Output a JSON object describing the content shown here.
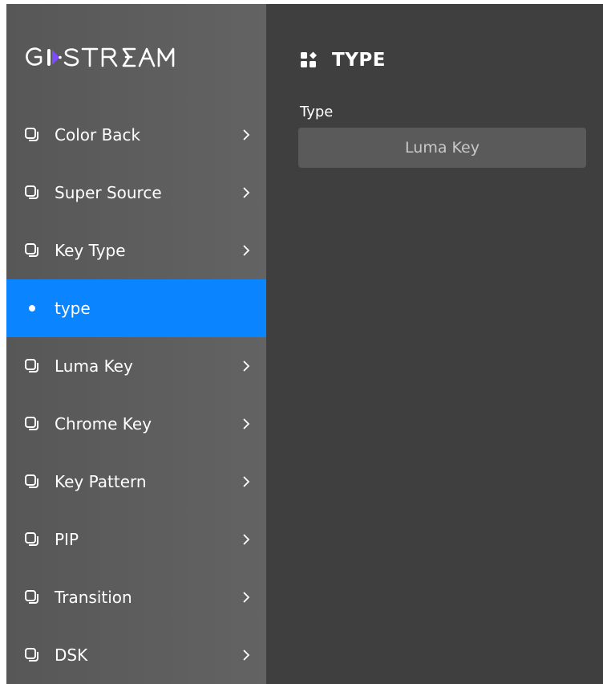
{
  "brand": {
    "logo_text": "GOSTREAM",
    "accent": "#7b4dff"
  },
  "sidebar": {
    "items": [
      {
        "label": "Color Back",
        "icon": "layers-icon",
        "active": false
      },
      {
        "label": "Super Source",
        "icon": "layers-icon",
        "active": false
      },
      {
        "label": "Key Type",
        "icon": "layers-icon",
        "active": false
      },
      {
        "label": "type",
        "icon": "dot-icon",
        "active": true
      },
      {
        "label": "Luma Key",
        "icon": "layers-icon",
        "active": false
      },
      {
        "label": "Chrome Key",
        "icon": "layers-icon",
        "active": false
      },
      {
        "label": "Key Pattern",
        "icon": "layers-icon",
        "active": false
      },
      {
        "label": "PIP",
        "icon": "layers-icon",
        "active": false
      },
      {
        "label": "Transition",
        "icon": "layers-icon",
        "active": false
      },
      {
        "label": "DSK",
        "icon": "layers-icon",
        "active": false
      }
    ]
  },
  "main": {
    "header_icon": "grid-shapes-icon",
    "title": "TYPE",
    "field": {
      "label": "Type",
      "value": "Luma Key"
    }
  },
  "colors": {
    "active_item": "#0a84ff",
    "sidebar_bg": "#5e5e5e",
    "main_bg": "#3f3f3f",
    "select_bg": "#5a5a5a"
  }
}
